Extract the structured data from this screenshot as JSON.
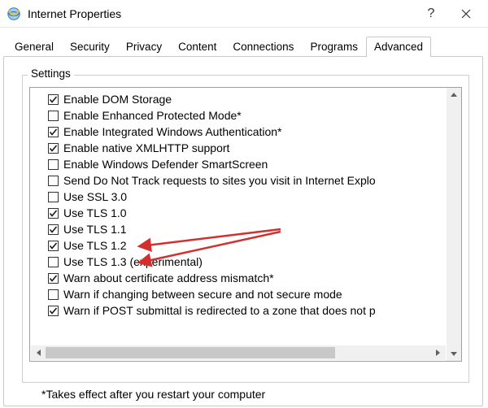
{
  "window": {
    "title": "Internet Properties",
    "help_glyph": "?",
    "close_tooltip": "Close"
  },
  "tabs": [
    {
      "label": "General",
      "active": false
    },
    {
      "label": "Security",
      "active": false
    },
    {
      "label": "Privacy",
      "active": false
    },
    {
      "label": "Content",
      "active": false
    },
    {
      "label": "Connections",
      "active": false
    },
    {
      "label": "Programs",
      "active": false
    },
    {
      "label": "Advanced",
      "active": true
    }
  ],
  "settings_group": {
    "legend": "Settings",
    "items": [
      {
        "checked": true,
        "label": "Enable DOM Storage"
      },
      {
        "checked": false,
        "label": "Enable Enhanced Protected Mode*"
      },
      {
        "checked": true,
        "label": "Enable Integrated Windows Authentication*"
      },
      {
        "checked": true,
        "label": "Enable native XMLHTTP support"
      },
      {
        "checked": false,
        "label": "Enable Windows Defender SmartScreen"
      },
      {
        "checked": false,
        "label": "Send Do Not Track requests to sites you visit in Internet Explo"
      },
      {
        "checked": false,
        "label": "Use SSL 3.0"
      },
      {
        "checked": true,
        "label": "Use TLS 1.0"
      },
      {
        "checked": true,
        "label": "Use TLS 1.1"
      },
      {
        "checked": true,
        "label": "Use TLS 1.2"
      },
      {
        "checked": false,
        "label": "Use TLS 1.3 (experimental)"
      },
      {
        "checked": true,
        "label": "Warn about certificate address mismatch*"
      },
      {
        "checked": false,
        "label": "Warn if changing between secure and not secure mode"
      },
      {
        "checked": true,
        "label": "Warn if POST submittal is redirected to a zone that does not p"
      }
    ]
  },
  "footnote": "*Takes effect after you restart your computer",
  "annotations": {
    "arrow_color": "#d32f2f",
    "arrows": [
      {
        "from": [
          345,
          282
        ],
        "to": [
          172,
          303
        ]
      },
      {
        "from": [
          345,
          285
        ],
        "to": [
          172,
          323
        ]
      }
    ]
  }
}
